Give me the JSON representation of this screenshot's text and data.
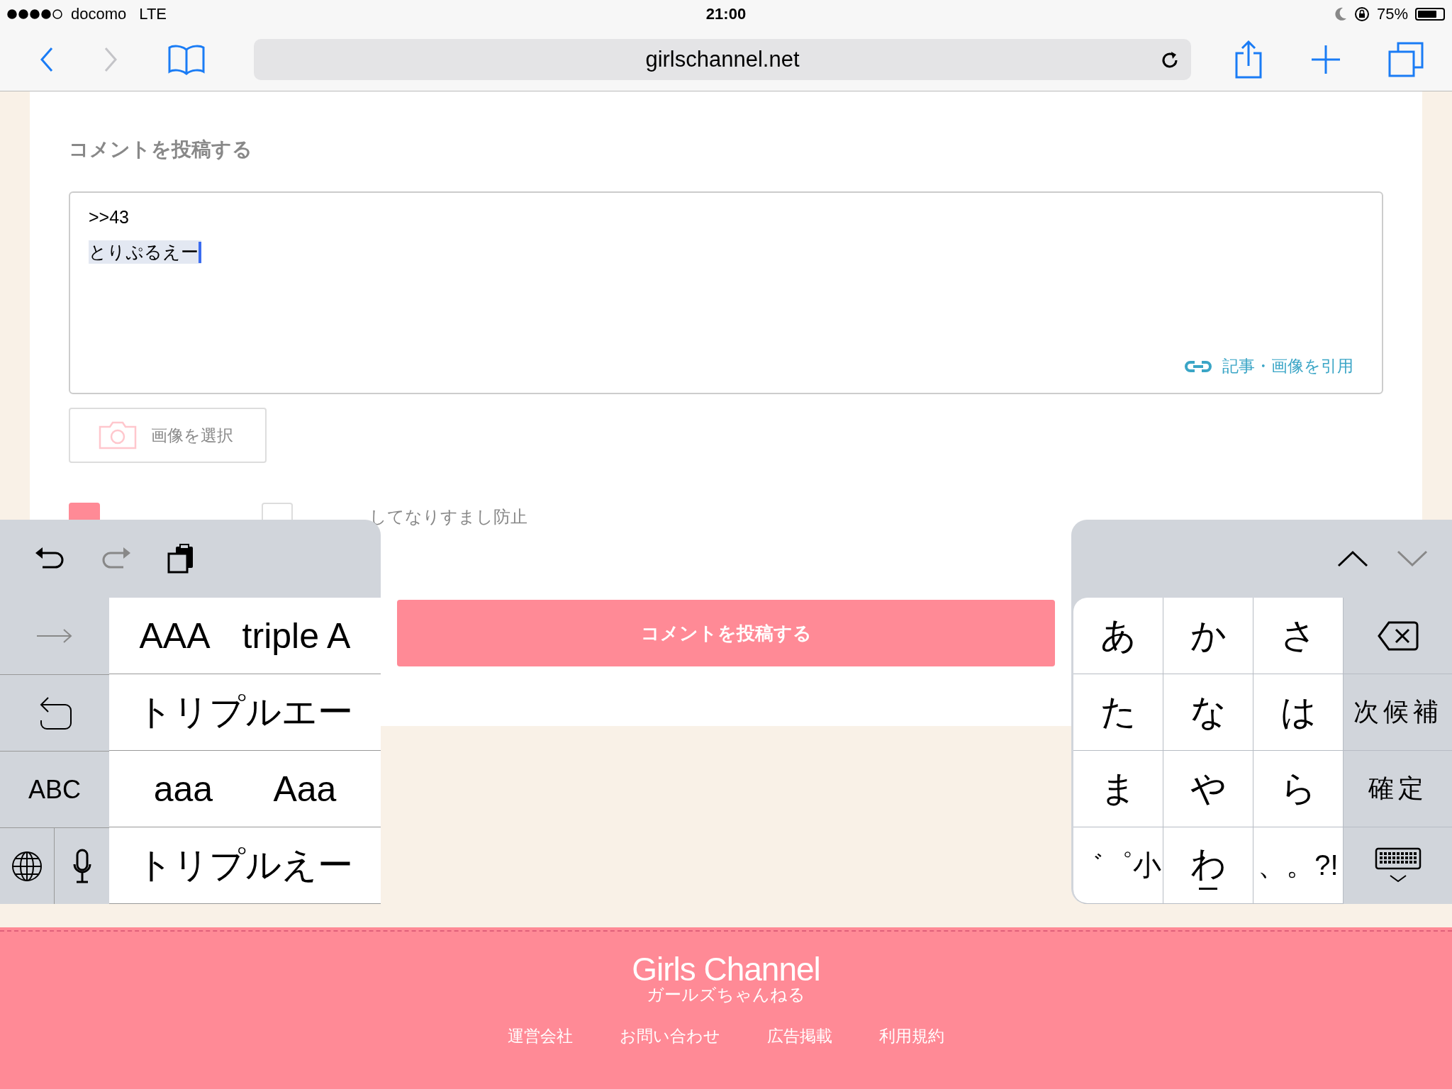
{
  "status_bar": {
    "carrier": "docomo",
    "network": "LTE",
    "time": "21:00",
    "battery": "75%"
  },
  "browser": {
    "url": "girlschannel.net"
  },
  "comment_form": {
    "title": "コメントを投稿する",
    "lines": [
      {
        "text": ">>43",
        "marked": false
      },
      {
        "text": "とりぷるえー",
        "marked": true
      }
    ],
    "quote_link": "記事・画像を引用",
    "image_button": "画像を選択",
    "options": [
      {
        "checked": true
      },
      {
        "label": "してなりすまし防止",
        "checked": false
      }
    ],
    "submit": "コメントを投稿する"
  },
  "keyboard": {
    "candidates": [
      [
        "AAA",
        "triple A"
      ],
      [
        "トリプルエー"
      ],
      [
        "aaa",
        "Aaa"
      ],
      [
        "トリプルえー"
      ]
    ],
    "side_key": "ABC",
    "kana_keys": [
      "あ",
      "か",
      "さ",
      "た",
      "な",
      "は",
      "ま",
      "や",
      "ら",
      "゛゜小",
      "わ",
      "、。?!"
    ],
    "function_keys": [
      {
        "kind": "delete"
      },
      {
        "kind": "text",
        "label": "次候補"
      },
      {
        "kind": "text",
        "label": "確定"
      },
      {
        "kind": "dismiss"
      }
    ]
  },
  "footer": {
    "logo": "Girls Channel",
    "logo_sub": "ガールズちゃんねる",
    "links": [
      "運営会社",
      "お問い合わせ",
      "広告掲載",
      "利用規約"
    ]
  }
}
